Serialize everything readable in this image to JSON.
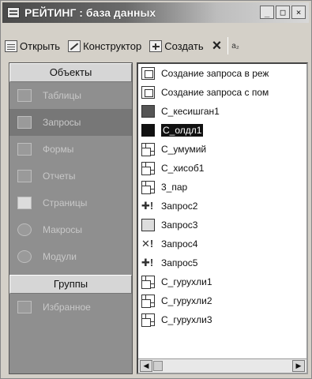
{
  "window": {
    "title": "РЕЙТИНГ : база данных",
    "buttons": {
      "minimize": "_",
      "maximize": "□",
      "close": "×"
    }
  },
  "toolbar": {
    "open_label": "Открыть",
    "design_label": "Конструктор",
    "create_label": "Создать",
    "delete_label": "×",
    "extra_label": "a₂"
  },
  "left_pane": {
    "objects_header": "Объекты",
    "objects": [
      {
        "label": "Таблицы",
        "icon": "table-icon"
      },
      {
        "label": "Запросы",
        "icon": "query-icon",
        "selected": true
      },
      {
        "label": "Формы",
        "icon": "form-icon"
      },
      {
        "label": "Отчеты",
        "icon": "report-icon"
      },
      {
        "label": "Страницы",
        "icon": "page-icon"
      },
      {
        "label": "Макросы",
        "icon": "macro-icon"
      },
      {
        "label": "Модули",
        "icon": "module-icon"
      }
    ],
    "groups_header": "Группы",
    "groups": [
      {
        "label": "Избранное",
        "icon": "favorites-icon"
      }
    ]
  },
  "right_pane": {
    "items": [
      {
        "label": "Создание запроса в реж",
        "icon": "wizard-icon"
      },
      {
        "label": "Создание запроса с пом",
        "icon": "wizard-icon"
      },
      {
        "label": "С_кесишган1",
        "icon": "crosstab-icon"
      },
      {
        "label": "С_олдл1",
        "icon": "black-icon",
        "selected": true
      },
      {
        "label": "С_умумий",
        "icon": "select-query-icon"
      },
      {
        "label": "С_хисоб1",
        "icon": "select-query-icon"
      },
      {
        "label": "3_пар",
        "icon": "select-query-icon"
      },
      {
        "label": "Запрос2",
        "icon": "append-query-icon"
      },
      {
        "label": "Запрос3",
        "icon": "update-query-icon"
      },
      {
        "label": "Запрос4",
        "icon": "delete-query-icon"
      },
      {
        "label": "Запрос5",
        "icon": "append-query-icon"
      },
      {
        "label": "С_гурухли1",
        "icon": "select-query-icon"
      },
      {
        "label": "С_гурухли2",
        "icon": "select-query-icon"
      },
      {
        "label": "С_гурухли3",
        "icon": "select-query-icon"
      }
    ]
  }
}
